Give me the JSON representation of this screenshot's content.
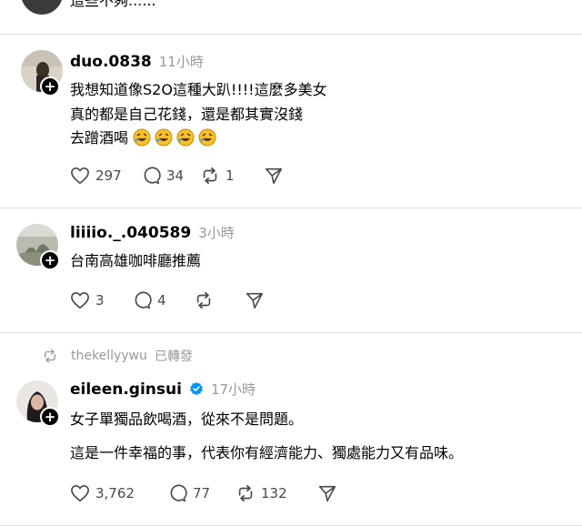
{
  "top_snippet": {
    "text": "這些不夠......"
  },
  "posts": [
    {
      "username": "duo.0838",
      "time": "11小時",
      "lines": [
        "我想知道像S2O這種大趴!!!!這麼多美女",
        "真的都是自己花錢，還是都其實沒錢",
        "去蹭酒喝"
      ],
      "emoji_icons": [
        "rolling-laugh-emoji",
        "rolling-laugh-emoji",
        "rolling-laugh-emoji",
        "rolling-laugh-emoji"
      ],
      "likes": "297",
      "replies": "34",
      "reposts": "1"
    },
    {
      "username": "liiiio._.040589",
      "time": "3小時",
      "lines": [
        "台南高雄咖啡廳推薦"
      ],
      "likes": "3",
      "replies": "4",
      "reposts": ""
    },
    {
      "repost_by": "thekellyywu",
      "repost_label": "已轉發",
      "username": "eileen.ginsui",
      "verified": true,
      "time": "17小時",
      "lines": [
        "女子單獨品飲喝酒，從來不是問題。",
        "這是一件幸福的事，代表你有經濟能力、獨處能力又有品味。"
      ],
      "likes": "3,762",
      "replies": "77",
      "reposts": "132"
    }
  ],
  "colors": {
    "muted": "#999999",
    "icon": "#4a4a4a",
    "verified": "#0095f6",
    "divider": "#dcdcdc"
  },
  "icons": [
    "heart-icon",
    "comment-icon",
    "repost-icon",
    "share-icon",
    "plus-icon",
    "verified-icon"
  ]
}
